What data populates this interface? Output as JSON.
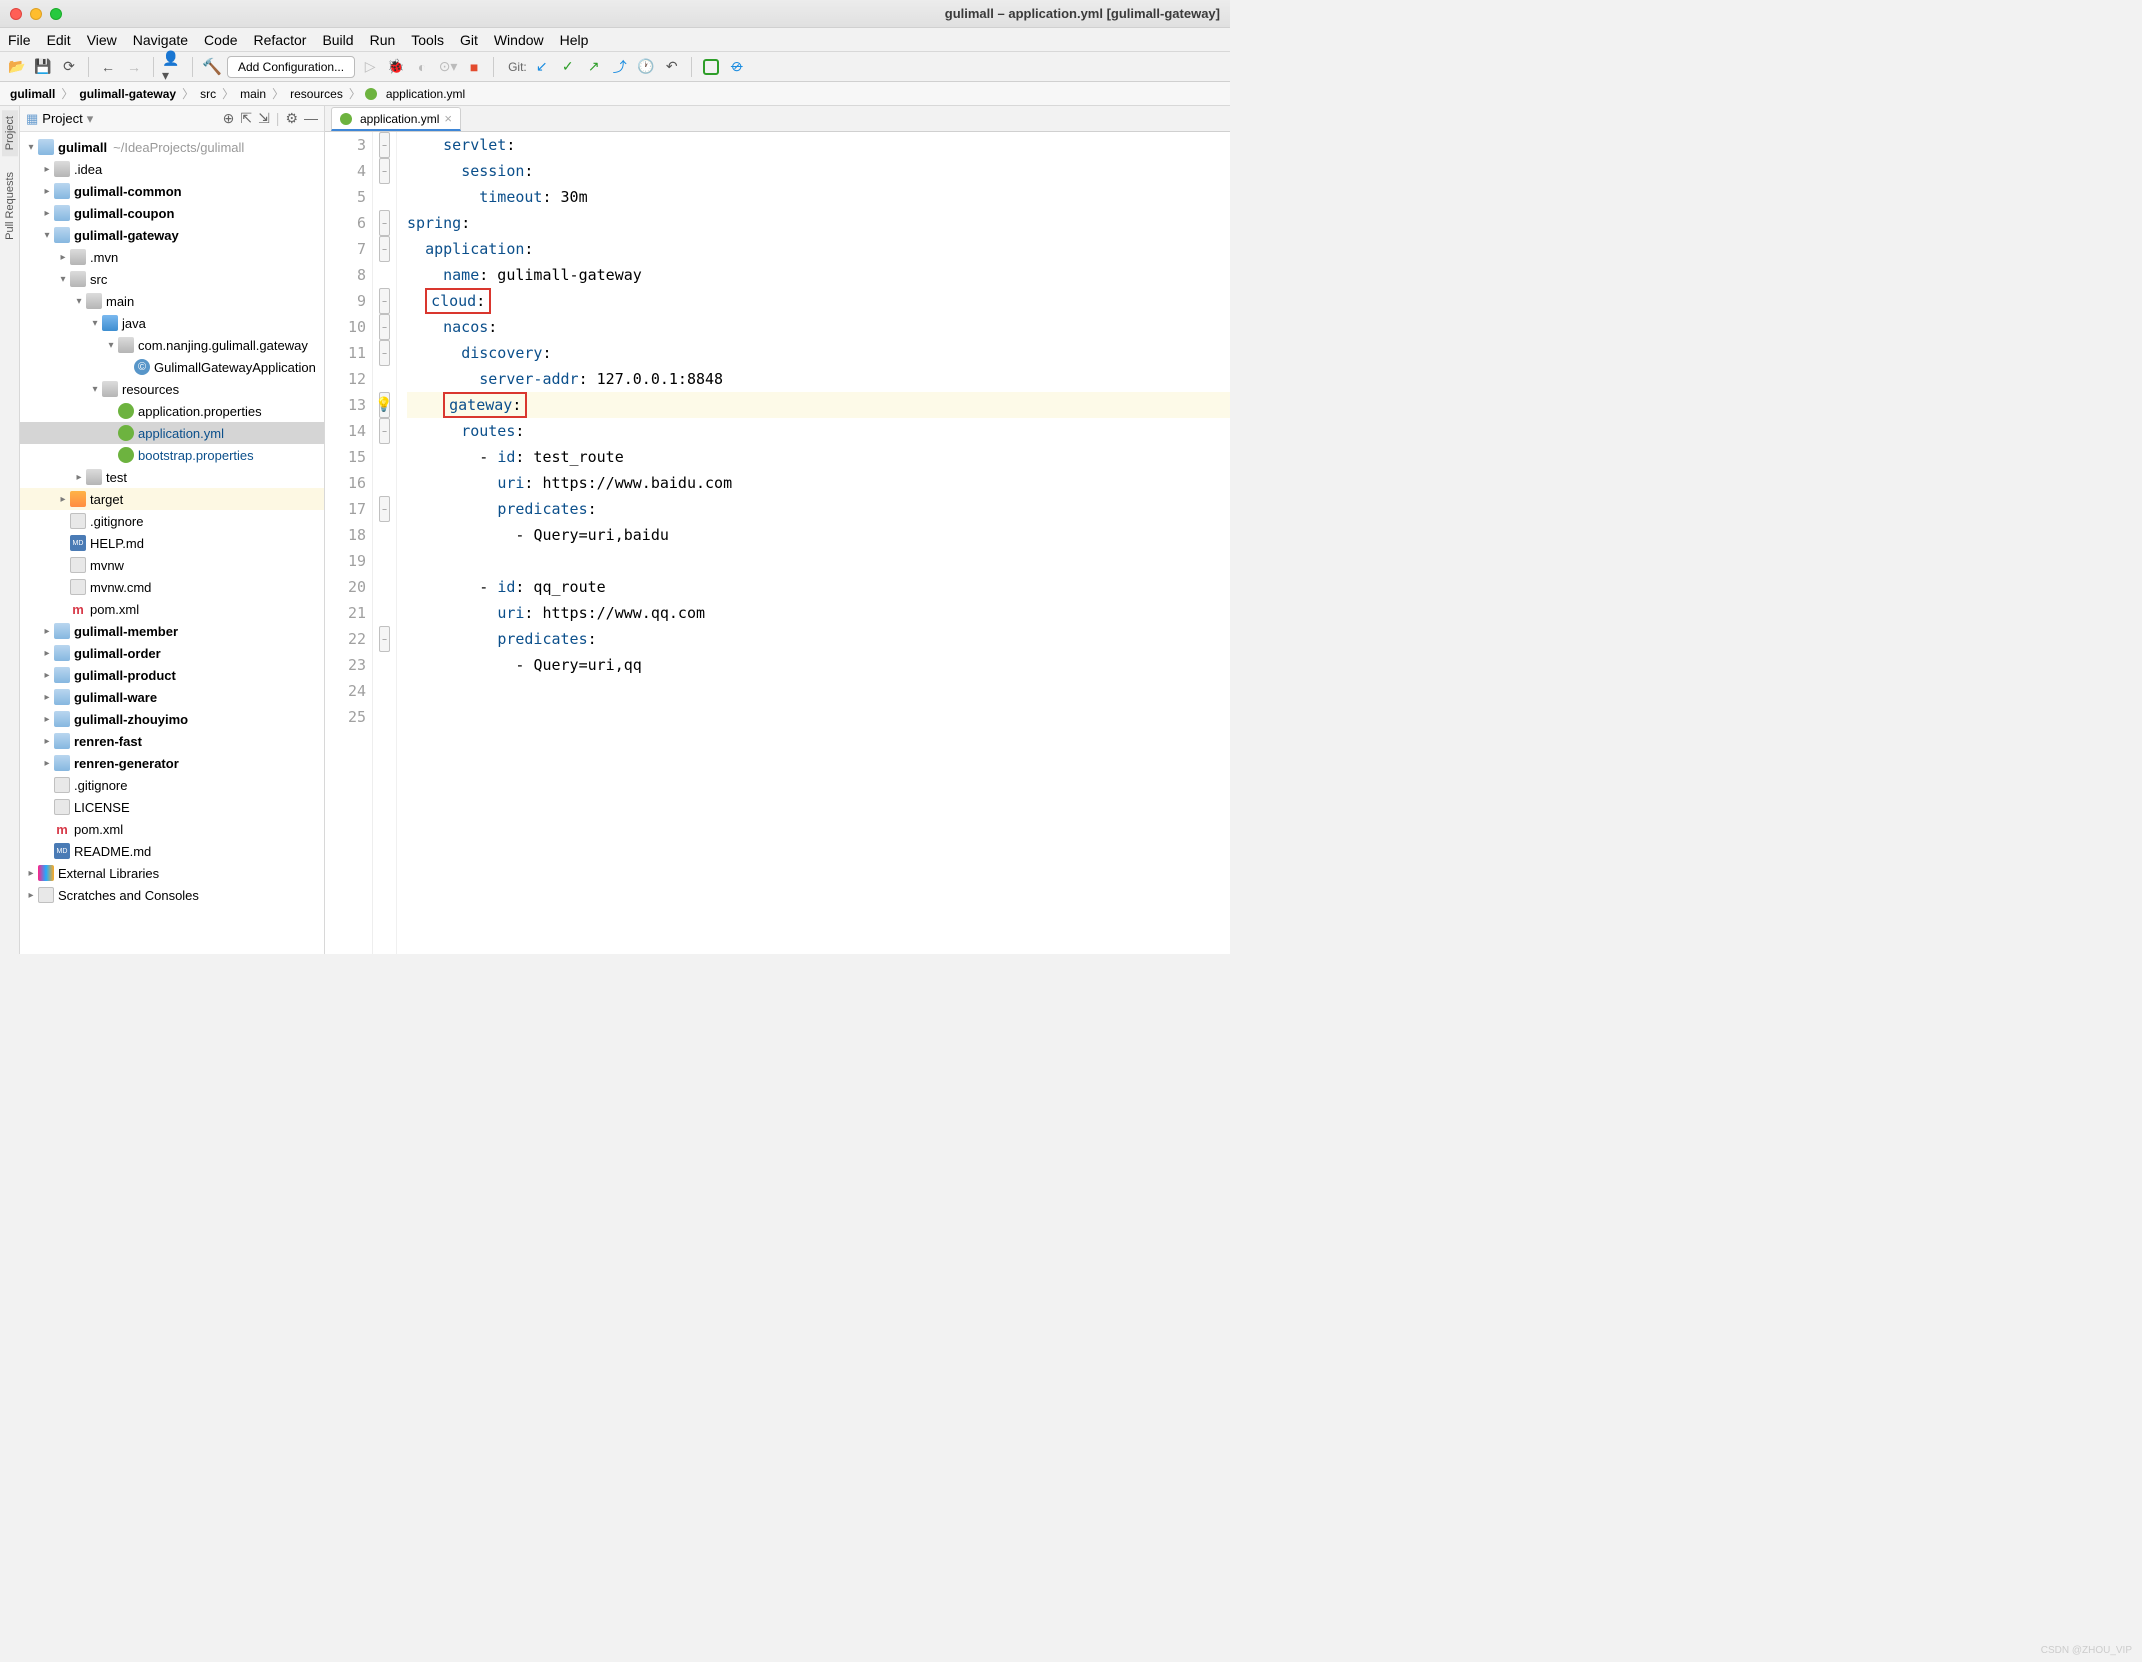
{
  "title": "gulimall – application.yml [gulimall-gateway]",
  "menu": [
    "File",
    "Edit",
    "View",
    "Navigate",
    "Code",
    "Refactor",
    "Build",
    "Run",
    "Tools",
    "Git",
    "Window",
    "Help"
  ],
  "toolbar": {
    "add_config": "Add Configuration...",
    "git_label": "Git:"
  },
  "breadcrumb": [
    "gulimall",
    "gulimall-gateway",
    "src",
    "main",
    "resources",
    "application.yml"
  ],
  "project_label": "Project",
  "tree": {
    "root": "gulimall",
    "root_path": "~/IdeaProjects/gulimall",
    "idea": ".idea",
    "common": "gulimall-common",
    "coupon": "gulimall-coupon",
    "gateway": "gulimall-gateway",
    "mvn": ".mvn",
    "src": "src",
    "main_dir": "main",
    "java": "java",
    "pkg": "com.nanjing.gulimall.gateway",
    "app_class": "GulimallGatewayApplication",
    "resources": "resources",
    "app_props": "application.properties",
    "app_yml": "application.yml",
    "bootstrap": "bootstrap.properties",
    "test": "test",
    "target": "target",
    "gitignore": ".gitignore",
    "help": "HELP.md",
    "mvnw": "mvnw",
    "mvnwcmd": "mvnw.cmd",
    "pom": "pom.xml",
    "member": "gulimall-member",
    "order": "gulimall-order",
    "product": "gulimall-product",
    "ware": "gulimall-ware",
    "zhouyimo": "gulimall-zhouyimo",
    "renren_fast": "renren-fast",
    "renren_gen": "renren-generator",
    "license": "LICENSE",
    "readme": "README.md",
    "ext_lib": "External Libraries",
    "scratches": "Scratches and Consoles"
  },
  "editor": {
    "tab_name": "application.yml",
    "line_start": 3,
    "lines": [
      {
        "n": 3,
        "indent": 2,
        "key": "servlet",
        "val": ""
      },
      {
        "n": 4,
        "indent": 3,
        "key": "session",
        "val": ""
      },
      {
        "n": 5,
        "indent": 4,
        "key": "timeout",
        "val": " 30m"
      },
      {
        "n": 6,
        "indent": 0,
        "key": "spring",
        "val": ""
      },
      {
        "n": 7,
        "indent": 1,
        "key": "application",
        "val": ""
      },
      {
        "n": 8,
        "indent": 2,
        "key": "name",
        "val": " gulimall-gateway"
      },
      {
        "n": 9,
        "indent": 1,
        "key": "cloud",
        "val": "",
        "box": true
      },
      {
        "n": 10,
        "indent": 2,
        "key": "nacos",
        "val": ""
      },
      {
        "n": 11,
        "indent": 3,
        "key": "discovery",
        "val": ""
      },
      {
        "n": 12,
        "indent": 4,
        "key": "server-addr",
        "val": " 127.0.0.1:8848"
      },
      {
        "n": 13,
        "indent": 2,
        "key": "gateway",
        "val": "",
        "box": true,
        "hl": true,
        "bulb": true
      },
      {
        "n": 14,
        "indent": 3,
        "key": "routes",
        "val": ""
      },
      {
        "n": 15,
        "indent": 4,
        "dash": true,
        "key": "id",
        "val": " test_route"
      },
      {
        "n": 16,
        "indent": 5,
        "key": "uri",
        "val": " https://www.baidu.com"
      },
      {
        "n": 17,
        "indent": 5,
        "key": "predicates",
        "val": ""
      },
      {
        "n": 18,
        "indent": 6,
        "dash": true,
        "raw": "Query=uri,baidu"
      },
      {
        "n": 19,
        "indent": 0,
        "empty": true
      },
      {
        "n": 20,
        "indent": 4,
        "dash": true,
        "key": "id",
        "val": " qq_route"
      },
      {
        "n": 21,
        "indent": 5,
        "key": "uri",
        "val": " https://www.qq.com"
      },
      {
        "n": 22,
        "indent": 5,
        "key": "predicates",
        "val": ""
      },
      {
        "n": 23,
        "indent": 6,
        "dash": true,
        "raw": "Query=uri,qq"
      },
      {
        "n": 24,
        "indent": 0,
        "empty": true
      },
      {
        "n": 25,
        "indent": 0,
        "empty": true
      }
    ]
  },
  "watermark": "CSDN @ZHOU_VIP"
}
